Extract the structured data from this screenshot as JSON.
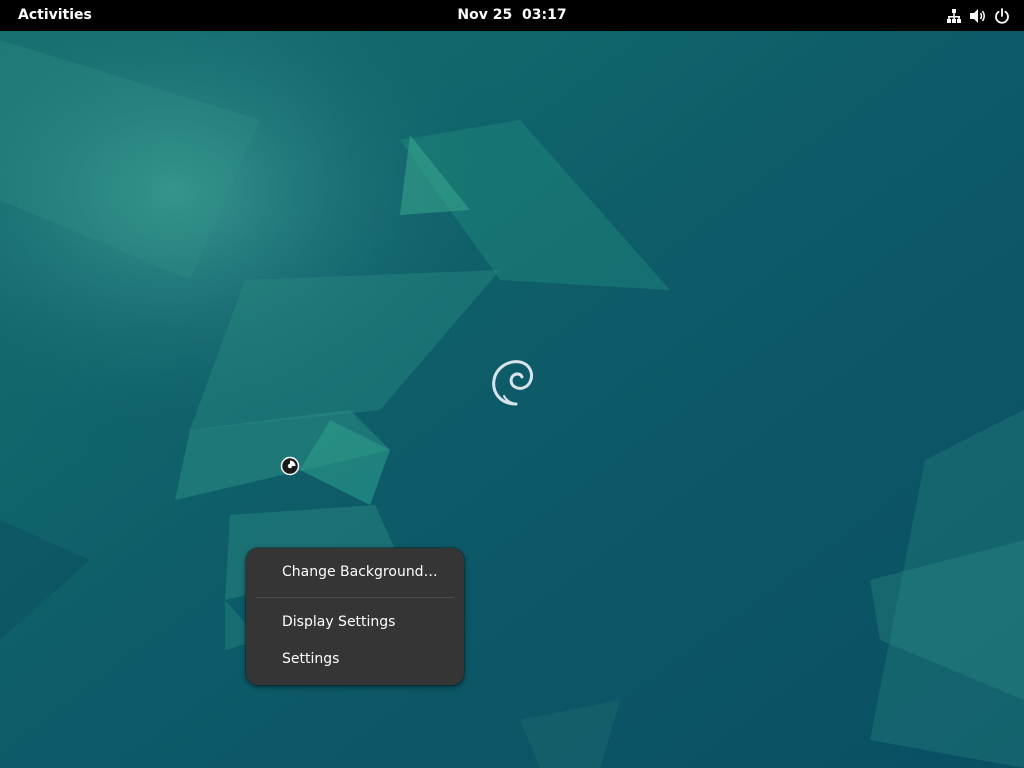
{
  "topbar": {
    "activities_label": "Activities",
    "date": "Nov 25",
    "time": "03:17",
    "status_icons": [
      "network-wired-icon",
      "speaker-volume-icon",
      "power-icon"
    ]
  },
  "desktop": {
    "background_color": "#0c5766",
    "logo": "debian-swirl-logo"
  },
  "context_menu": {
    "items": [
      {
        "label": "Change Background…"
      },
      {
        "label": "Display Settings"
      },
      {
        "label": "Settings"
      }
    ]
  }
}
